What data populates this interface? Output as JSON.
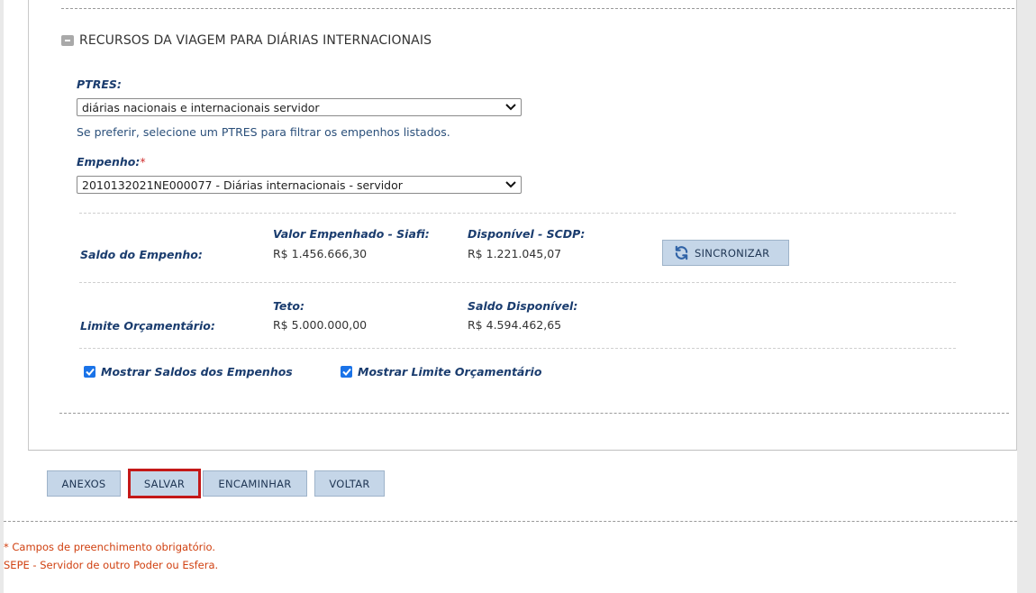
{
  "section": {
    "title": "RECURSOS DA VIAGEM PARA DIÁRIAS INTERNACIONAIS",
    "collapse_icon": "minus-icon"
  },
  "ptres": {
    "label": "PTRES:",
    "selected": "diárias nacionais e internacionais servidor",
    "hint": "Se preferir, selecione um PTRES para filtrar os empenhos listados."
  },
  "empenho": {
    "label": "Empenho:",
    "required_mark": "*",
    "selected": "2010132021NE000077 - Diárias internacionais - servidor"
  },
  "saldo": {
    "row_label": "Saldo do Empenho:",
    "col1_label": "Valor Empenhado - Siafi:",
    "col1_value": "R$ 1.456.666,30",
    "col2_label": "Disponível - SCDP:",
    "col2_value": "R$ 1.221.045,07",
    "sync_label": "SINCRONIZAR",
    "sync_icon": "refresh-icon"
  },
  "limite": {
    "row_label": "Limite Orçamentário:",
    "col1_label": "Teto:",
    "col1_value": "R$ 5.000.000,00",
    "col2_label": "Saldo Disponível:",
    "col2_value": "R$ 4.594.462,65"
  },
  "options": {
    "show_saldos_label": "Mostrar Saldos dos Empenhos",
    "show_saldos_checked": true,
    "show_limite_label": "Mostrar Limite Orçamentário",
    "show_limite_checked": true
  },
  "actions": {
    "anexos": "ANEXOS",
    "salvar": "SALVAR",
    "encaminhar": "ENCAMINHAR",
    "voltar": "VOLTAR"
  },
  "footer": {
    "required_note": "* Campos de preenchimento obrigatório.",
    "sepe_note": "SEPE - Servidor de outro Poder ou Esfera."
  },
  "colors": {
    "accent_label": "#1a3c6e",
    "button_bg": "#c5d6e8",
    "highlight": "#c41818",
    "footer_text": "#d04010",
    "checkbox": "#1a73e8"
  }
}
